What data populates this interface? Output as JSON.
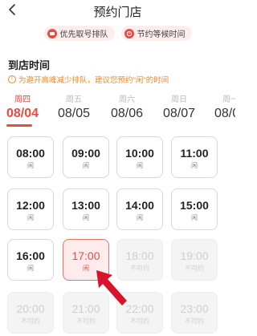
{
  "header": {
    "title": "预约门店"
  },
  "badges": [
    {
      "label": "优先取号排队",
      "icon": "priority-icon",
      "color": "#e54d42"
    },
    {
      "label": "节约等候时间",
      "icon": "time-saving-icon",
      "color": "#e54d42"
    }
  ],
  "section": {
    "title": "到店时间",
    "tip": "为避开高峰减少排队，建议您预约\"闲\"的时间"
  },
  "days": [
    {
      "weekday": "周四",
      "date": "08/04",
      "active": true
    },
    {
      "weekday": "周五",
      "date": "08/05",
      "active": false
    },
    {
      "weekday": "周六",
      "date": "08/06",
      "active": false
    },
    {
      "weekday": "周日",
      "date": "08/07",
      "active": false
    },
    {
      "weekday": "周一",
      "date": "08/08",
      "active": false
    }
  ],
  "slots": [
    {
      "time": "08:00",
      "status": "闲",
      "state": "available"
    },
    {
      "time": "09:00",
      "status": "闲",
      "state": "available"
    },
    {
      "time": "10:00",
      "status": "闲",
      "state": "available"
    },
    {
      "time": "11:00",
      "status": "闲",
      "state": "available"
    },
    {
      "time": "12:00",
      "status": "闲",
      "state": "available"
    },
    {
      "time": "13:00",
      "status": "闲",
      "state": "available"
    },
    {
      "time": "14:00",
      "status": "闲",
      "state": "available"
    },
    {
      "time": "15:00",
      "status": "闲",
      "state": "available"
    },
    {
      "time": "16:00",
      "status": "闲",
      "state": "available"
    },
    {
      "time": "17:00",
      "status": "闲",
      "state": "selected"
    },
    {
      "time": "18:00",
      "status": "不可约",
      "state": "disabled"
    },
    {
      "time": "19:00",
      "status": "不可约",
      "state": "disabled"
    },
    {
      "time": "20:00",
      "status": "不可约",
      "state": "disabled"
    },
    {
      "time": "21:00",
      "status": "不可约",
      "state": "disabled"
    },
    {
      "time": "22:00",
      "status": "不可约",
      "state": "disabled"
    },
    {
      "time": "23:00",
      "status": "不可约",
      "state": "disabled"
    }
  ],
  "colors": {
    "accent": "#e54d42",
    "tip": "#f08a24",
    "annotation_arrow": "#d6142b"
  }
}
